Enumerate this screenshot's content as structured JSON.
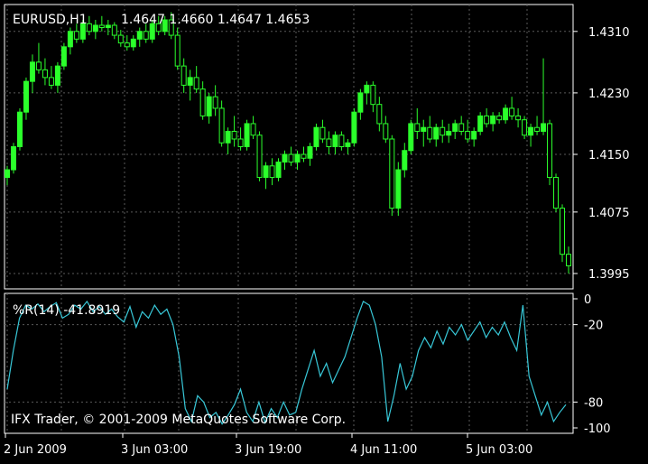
{
  "header": {
    "symbol_timeframe": "EURUSD,H1",
    "ohlc": "1.4647 1.4660 1.4647 1.4653"
  },
  "colors": {
    "background": "#000000",
    "frame": "#ffffff",
    "grid": "#5a5a5a",
    "bull_candle": "#2bff2b",
    "bear_candle": "#2bff2b",
    "indicator_line": "#38c8d8",
    "text": "#ffffff"
  },
  "indicator": {
    "label": "%R(14) -41.8919",
    "levels_labels": [
      "0",
      "-20",
      "-80",
      "-100"
    ]
  },
  "copyright": "IFX Trader, © 2001-2009 MetaQuotes Software Corp.",
  "chart_data": [
    {
      "type": "candlestick",
      "title": "EURUSD,H1",
      "ylim": [
        1.3975,
        1.4345
      ],
      "y_ticks": [
        "1.4310",
        "1.4230",
        "1.4150",
        "1.4075",
        "1.3995"
      ],
      "y_tick_values": [
        1.431,
        1.423,
        1.415,
        1.4075,
        1.3995
      ],
      "x_ticks": [
        "2 Jun 2009",
        "3 Jun 03:00",
        "3 Jun 19:00",
        "4 Jun 11:00",
        "5 Jun 03:00"
      ],
      "grid": true,
      "candles": [
        [
          1.412,
          1.4135,
          1.411,
          1.413
        ],
        [
          1.413,
          1.4165,
          1.4125,
          1.416
        ],
        [
          1.416,
          1.421,
          1.4155,
          1.4205
        ],
        [
          1.4205,
          1.425,
          1.4195,
          1.4245
        ],
        [
          1.4245,
          1.428,
          1.423,
          1.427
        ],
        [
          1.427,
          1.4295,
          1.4255,
          1.426
        ],
        [
          1.426,
          1.4275,
          1.424,
          1.425
        ],
        [
          1.425,
          1.4265,
          1.4235,
          1.424
        ],
        [
          1.424,
          1.427,
          1.423,
          1.4265
        ],
        [
          1.4265,
          1.4295,
          1.426,
          1.429
        ],
        [
          1.429,
          1.4315,
          1.428,
          1.431
        ],
        [
          1.431,
          1.432,
          1.4295,
          1.43
        ],
        [
          1.43,
          1.4325,
          1.4295,
          1.432
        ],
        [
          1.432,
          1.433,
          1.4305,
          1.431
        ],
        [
          1.431,
          1.4325,
          1.43,
          1.4318
        ],
        [
          1.4318,
          1.433,
          1.431,
          1.4315
        ],
        [
          1.4315,
          1.4325,
          1.4305,
          1.4318
        ],
        [
          1.4318,
          1.4322,
          1.43,
          1.4305
        ],
        [
          1.4305,
          1.4312,
          1.429,
          1.4295
        ],
        [
          1.4295,
          1.4305,
          1.4285,
          1.429
        ],
        [
          1.429,
          1.4305,
          1.4285,
          1.43
        ],
        [
          1.43,
          1.4315,
          1.429,
          1.431
        ],
        [
          1.431,
          1.432,
          1.4295,
          1.43
        ],
        [
          1.43,
          1.4325,
          1.4295,
          1.432
        ],
        [
          1.432,
          1.433,
          1.4305,
          1.431
        ],
        [
          1.431,
          1.433,
          1.4305,
          1.4325
        ],
        [
          1.4325,
          1.4335,
          1.43,
          1.4305
        ],
        [
          1.4305,
          1.4315,
          1.426,
          1.4265
        ],
        [
          1.4265,
          1.4275,
          1.423,
          1.424
        ],
        [
          1.424,
          1.426,
          1.422,
          1.425
        ],
        [
          1.425,
          1.4265,
          1.423,
          1.4235
        ],
        [
          1.4235,
          1.4245,
          1.4195,
          1.42
        ],
        [
          1.42,
          1.423,
          1.419,
          1.4225
        ],
        [
          1.4225,
          1.424,
          1.42,
          1.421
        ],
        [
          1.421,
          1.422,
          1.416,
          1.4165
        ],
        [
          1.4165,
          1.4185,
          1.415,
          1.418
        ],
        [
          1.418,
          1.42,
          1.416,
          1.417
        ],
        [
          1.417,
          1.4185,
          1.4155,
          1.416
        ],
        [
          1.416,
          1.4195,
          1.4155,
          1.419
        ],
        [
          1.419,
          1.42,
          1.417,
          1.4175
        ],
        [
          1.4175,
          1.418,
          1.4115,
          1.412
        ],
        [
          1.412,
          1.414,
          1.4105,
          1.4135
        ],
        [
          1.4135,
          1.4145,
          1.411,
          1.412
        ],
        [
          1.412,
          1.4145,
          1.4115,
          1.414
        ],
        [
          1.414,
          1.4155,
          1.413,
          1.415
        ],
        [
          1.415,
          1.416,
          1.4135,
          1.414
        ],
        [
          1.414,
          1.4155,
          1.413,
          1.415
        ],
        [
          1.415,
          1.416,
          1.414,
          1.4145
        ],
        [
          1.4145,
          1.4165,
          1.4135,
          1.416
        ],
        [
          1.416,
          1.419,
          1.4155,
          1.4185
        ],
        [
          1.4185,
          1.4195,
          1.4165,
          1.417
        ],
        [
          1.417,
          1.418,
          1.415,
          1.416
        ],
        [
          1.416,
          1.418,
          1.415,
          1.4175
        ],
        [
          1.4175,
          1.418,
          1.4155,
          1.416
        ],
        [
          1.416,
          1.417,
          1.415,
          1.4165
        ],
        [
          1.4165,
          1.421,
          1.416,
          1.4205
        ],
        [
          1.4205,
          1.4235,
          1.4195,
          1.423
        ],
        [
          1.423,
          1.4245,
          1.4215,
          1.424
        ],
        [
          1.424,
          1.4245,
          1.4205,
          1.4215
        ],
        [
          1.4215,
          1.4225,
          1.418,
          1.419
        ],
        [
          1.419,
          1.42,
          1.4165,
          1.417
        ],
        [
          1.417,
          1.4175,
          1.407,
          1.408
        ],
        [
          1.408,
          1.414,
          1.407,
          1.413
        ],
        [
          1.413,
          1.4165,
          1.412,
          1.4155
        ],
        [
          1.4155,
          1.4195,
          1.415,
          1.419
        ],
        [
          1.419,
          1.421,
          1.417,
          1.418
        ],
        [
          1.418,
          1.4195,
          1.416,
          1.4185
        ],
        [
          1.4185,
          1.42,
          1.4165,
          1.417
        ],
        [
          1.417,
          1.419,
          1.416,
          1.4185
        ],
        [
          1.4185,
          1.4195,
          1.4165,
          1.4175
        ],
        [
          1.4175,
          1.419,
          1.4165,
          1.418
        ],
        [
          1.418,
          1.4195,
          1.417,
          1.419
        ],
        [
          1.419,
          1.42,
          1.4175,
          1.418
        ],
        [
          1.418,
          1.4195,
          1.4165,
          1.417
        ],
        [
          1.417,
          1.4185,
          1.416,
          1.418
        ],
        [
          1.418,
          1.4205,
          1.4175,
          1.42
        ],
        [
          1.42,
          1.421,
          1.4185,
          1.419
        ],
        [
          1.419,
          1.4205,
          1.418,
          1.42
        ],
        [
          1.42,
          1.4205,
          1.419,
          1.4195
        ],
        [
          1.4195,
          1.4215,
          1.419,
          1.421
        ],
        [
          1.421,
          1.4225,
          1.4195,
          1.42
        ],
        [
          1.42,
          1.421,
          1.4185,
          1.4195
        ],
        [
          1.4195,
          1.42,
          1.417,
          1.4175
        ],
        [
          1.4175,
          1.419,
          1.416,
          1.4185
        ],
        [
          1.4185,
          1.42,
          1.4175,
          1.418
        ],
        [
          1.418,
          1.4275,
          1.4175,
          1.419
        ],
        [
          1.419,
          1.4195,
          1.411,
          1.412
        ],
        [
          1.412,
          1.4125,
          1.4075,
          1.408
        ],
        [
          1.408,
          1.4085,
          1.401,
          1.402
        ],
        [
          1.402,
          1.403,
          1.3995,
          1.4005
        ]
      ]
    },
    {
      "type": "line",
      "title": "%R(14) -41.8919",
      "ylim": [
        -100,
        0
      ],
      "y_ticks": [
        "0",
        "-20",
        "-80",
        "-100"
      ],
      "y_tick_values": [
        0,
        -20,
        -80,
        -100
      ],
      "series": [
        {
          "name": "%R(14)",
          "values": [
            -70,
            -40,
            -15,
            -5,
            -8,
            -4,
            -10,
            -6,
            -3,
            -15,
            -12,
            -5,
            -8,
            -2,
            -10,
            -6,
            -12,
            -8,
            -14,
            -18,
            -6,
            -22,
            -10,
            -15,
            -5,
            -12,
            -8,
            -20,
            -45,
            -85,
            -95,
            -75,
            -80,
            -92,
            -88,
            -97,
            -90,
            -82,
            -70,
            -88,
            -95,
            -80,
            -96,
            -85,
            -92,
            -80,
            -90,
            -88,
            -70,
            -55,
            -40,
            -60,
            -50,
            -65,
            -55,
            -45,
            -30,
            -15,
            -2,
            -5,
            -20,
            -45,
            -95,
            -75,
            -50,
            -70,
            -60,
            -40,
            -30,
            -38,
            -25,
            -35,
            -22,
            -28,
            -20,
            -32,
            -25,
            -18,
            -30,
            -22,
            -28,
            -18,
            -30,
            -40,
            -5,
            -60,
            -75,
            -90,
            -80,
            -95,
            -88,
            -82
          ]
        }
      ]
    }
  ]
}
